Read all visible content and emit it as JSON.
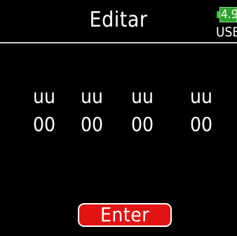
{
  "header": {
    "title": "Editar"
  },
  "status": {
    "battery_value": "4.9",
    "power_source": "USB",
    "battery_color": "#2ea22e"
  },
  "editor": {
    "columns": [
      {
        "top": "uu",
        "bottom": "00"
      },
      {
        "top": "uu",
        "bottom": "00"
      },
      {
        "top": "uu",
        "bottom": "00"
      },
      {
        "top": "uu",
        "bottom": "00"
      }
    ]
  },
  "actions": {
    "enter_label": "Enter",
    "enter_color": "#e21313"
  }
}
